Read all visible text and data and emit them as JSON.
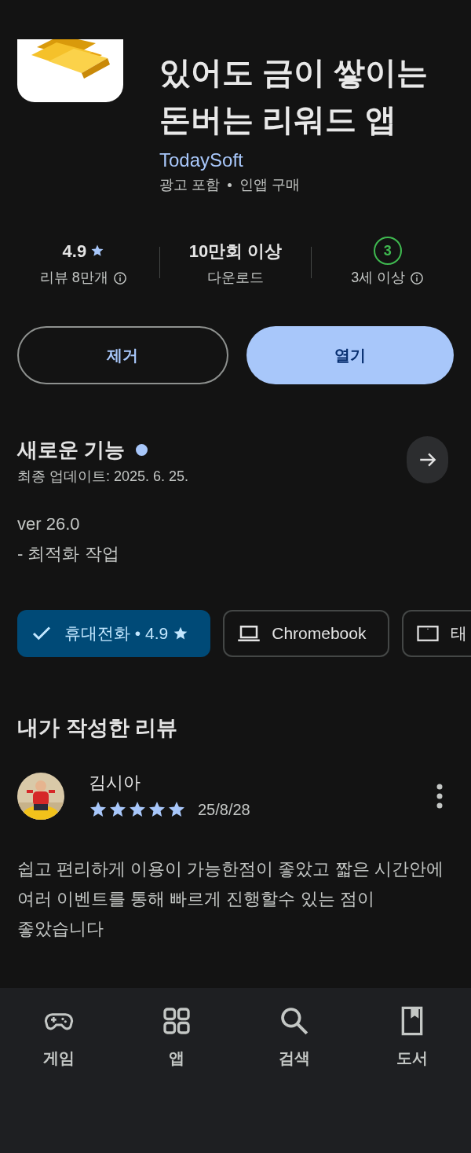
{
  "app": {
    "title_lines": [
      "있어도 금이 쌓이는",
      "돈버는 리워드 앱"
    ],
    "developer": "TodaySoft",
    "tags": [
      "광고 포함",
      "인앱 구매"
    ]
  },
  "stats": [
    {
      "kind": "rating",
      "value": "4.9",
      "label": "리뷰 8만개",
      "info": true
    },
    {
      "kind": "text",
      "value": "10만회 이상",
      "label": "다운로드",
      "info": false
    },
    {
      "kind": "age",
      "value": "3",
      "label": "3세 이상",
      "info": true
    }
  ],
  "actions": [
    {
      "label": "제거",
      "kind": "outlined"
    },
    {
      "label": "열기",
      "kind": "filled"
    }
  ],
  "whats_new": {
    "title": "새로운 기능",
    "new": true,
    "updated": "최종 업데이트: 2025. 6. 25.",
    "notes": [
      "ver 26.0",
      "- 최적화 작업"
    ]
  },
  "devices": [
    {
      "kind": "phone",
      "label": "휴대전화 • 4.9",
      "star": true,
      "selected": true
    },
    {
      "kind": "laptop",
      "label": "Chromebook",
      "star": false,
      "selected": false
    },
    {
      "kind": "tablet",
      "label": "태",
      "star": false,
      "selected": false
    }
  ],
  "my_review": {
    "heading": "내가 작성한 리뷰",
    "author": "김시아",
    "stars": 5,
    "date": "25/8/28",
    "text": "쉽고 편리하게 이용이 가능한점이 좋았고 짧은 시간안에 여러 이벤트를 통해 빠르게 진행할수 있는 점이 좋았습니다"
  },
  "bottom_nav": [
    {
      "kind": "games",
      "label": "게임"
    },
    {
      "kind": "apps",
      "label": "앱"
    },
    {
      "kind": "search",
      "label": "검색"
    },
    {
      "kind": "books",
      "label": "도서"
    }
  ]
}
